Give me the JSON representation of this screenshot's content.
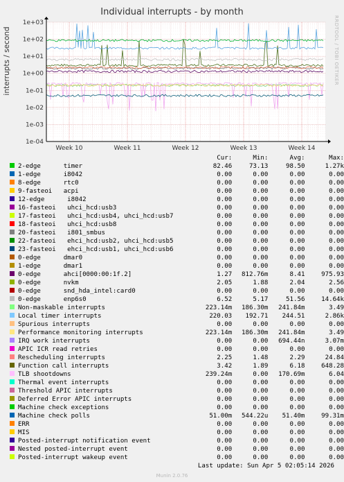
{
  "chart_data": {
    "type": "line",
    "title": "Individual interrupts - by month",
    "ylabel": "interrupts / second",
    "yscale": "log",
    "ylim": [
      0.0001,
      1000
    ],
    "yticks": [
      "1e+03",
      "1e+02",
      "1e+01",
      "1e+00",
      "1e-01",
      "1e-02",
      "1e-03",
      "1e-04"
    ],
    "xticks": [
      "Week 10",
      "Week 11",
      "Week 12",
      "Week 13",
      "Week 14"
    ],
    "grid": true,
    "series": [
      {
        "name": "Function call interrupts",
        "color": "#4a6e1a",
        "level": 3.0,
        "spikes": true
      },
      {
        "name": "Local timer interrupts",
        "color": "#5aa5e0",
        "level": 30.0,
        "spikes": true
      },
      {
        "name": "Non-maskable interrupts",
        "color": "#7ccf7c",
        "level": 0.2
      },
      {
        "name": "TLB shootdowns",
        "color": "#f0a8f0",
        "level": 0.25,
        "noisy": true
      },
      {
        "name": "Performance monitoring interrupts",
        "color": "#f0d878",
        "level": 0.2
      },
      {
        "name": "Machine check polls",
        "color": "#0b5e7a",
        "level": 0.05
      },
      {
        "name": "ahci[0000:00:1f.2]",
        "color": "#5a0a64",
        "level": 1.3
      },
      {
        "name": "timer",
        "color": "#00b030",
        "level": 85.0
      },
      {
        "name": "enp6s0",
        "color": "#c0c0c0",
        "level": 6.5
      },
      {
        "name": "nvkm",
        "color": "#787878",
        "level": 2.0
      },
      {
        "name": "Rescheduling interrupts",
        "color": "#e07050",
        "level": 2.2
      }
    ]
  },
  "legend": {
    "headers": [
      "Cur:",
      "Min:",
      "Avg:",
      "Max:"
    ],
    "rows": [
      {
        "label": "2-edge      timer",
        "color": "#00cc00",
        "cur": "82.46",
        "min": "73.13",
        "avg": "98.50",
        "max": "1.27k"
      },
      {
        "label": "1-edge      i8042",
        "color": "#0066b3",
        "cur": "0.00",
        "min": "0.00",
        "avg": "0.00",
        "max": "0.00"
      },
      {
        "label": "8-edge      rtc0",
        "color": "#ff8000",
        "cur": "0.00",
        "min": "0.00",
        "avg": "0.00",
        "max": "0.00"
      },
      {
        "label": "9-fasteoi   acpi",
        "color": "#ffcc00",
        "cur": "0.00",
        "min": "0.00",
        "avg": "0.00",
        "max": "0.00"
      },
      {
        "label": "12-edge      i8042",
        "color": "#330099",
        "cur": "0.00",
        "min": "0.00",
        "avg": "0.00",
        "max": "0.00"
      },
      {
        "label": "16-fasteoi   uhci_hcd:usb3",
        "color": "#990099",
        "cur": "0.00",
        "min": "0.00",
        "avg": "0.00",
        "max": "0.00"
      },
      {
        "label": "17-fasteoi   uhci_hcd:usb4, uhci_hcd:usb7",
        "color": "#ccff00",
        "cur": "0.00",
        "min": "0.00",
        "avg": "0.00",
        "max": "0.00"
      },
      {
        "label": "18-fasteoi   uhci_hcd:usb8",
        "color": "#ff0000",
        "cur": "0.00",
        "min": "0.00",
        "avg": "0.00",
        "max": "0.00"
      },
      {
        "label": "20-fasteoi   i801_smbus",
        "color": "#808080",
        "cur": "0.00",
        "min": "0.00",
        "avg": "0.00",
        "max": "0.00"
      },
      {
        "label": "22-fasteoi   ehci_hcd:usb2, uhci_hcd:usb5",
        "color": "#008f00",
        "cur": "0.00",
        "min": "0.00",
        "avg": "0.00",
        "max": "0.00"
      },
      {
        "label": "23-fasteoi   ehci_hcd:usb1, uhci_hcd:usb6",
        "color": "#00487d",
        "cur": "0.00",
        "min": "0.00",
        "avg": "0.00",
        "max": "0.00"
      },
      {
        "label": "0-edge      dmar0",
        "color": "#b35a00",
        "cur": "0.00",
        "min": "0.00",
        "avg": "0.00",
        "max": "0.00"
      },
      {
        "label": "1-edge      dmar1",
        "color": "#b38f00",
        "cur": "0.00",
        "min": "0.00",
        "avg": "0.00",
        "max": "0.00"
      },
      {
        "label": "0-edge      ahci[0000:00:1f.2]",
        "color": "#6b006b",
        "cur": "1.27",
        "min": "812.76m",
        "avg": "8.41",
        "max": "975.93"
      },
      {
        "label": "0-edge      nvkm",
        "color": "#8fb300",
        "cur": "2.05",
        "min": "1.88",
        "avg": "2.04",
        "max": "2.56"
      },
      {
        "label": "0-edge      snd_hda_intel:card0",
        "color": "#b30000",
        "cur": "0.00",
        "min": "0.00",
        "avg": "0.00",
        "max": "0.00"
      },
      {
        "label": "0-edge      enp6s0",
        "color": "#bebebe",
        "cur": "6.52",
        "min": "5.17",
        "avg": "51.56",
        "max": "14.64k"
      },
      {
        "label": "Non-maskable interrupts",
        "color": "#80ff80",
        "cur": "223.14m",
        "min": "186.30m",
        "avg": "241.84m",
        "max": "3.49"
      },
      {
        "label": "Local timer interrupts",
        "color": "#80c9ff",
        "cur": "220.03",
        "min": "192.71",
        "avg": "244.51",
        "max": "2.86k"
      },
      {
        "label": "Spurious interrupts",
        "color": "#ffc080",
        "cur": "0.00",
        "min": "0.00",
        "avg": "0.00",
        "max": "0.00"
      },
      {
        "label": "Performance monitoring interrupts",
        "color": "#ffe680",
        "cur": "223.14m",
        "min": "186.30m",
        "avg": "241.84m",
        "max": "3.49"
      },
      {
        "label": "IRQ work interrupts",
        "color": "#aa80ff",
        "cur": "0.00",
        "min": "0.00",
        "avg": "694.44n",
        "max": "3.07m"
      },
      {
        "label": "APIC ICR read retries",
        "color": "#ee00cc",
        "cur": "0.00",
        "min": "0.00",
        "avg": "0.00",
        "max": "0.00"
      },
      {
        "label": "Rescheduling interrupts",
        "color": "#ff8080",
        "cur": "2.25",
        "min": "1.48",
        "avg": "2.29",
        "max": "24.84"
      },
      {
        "label": "Function call interrupts",
        "color": "#666600",
        "cur": "3.42",
        "min": "1.89",
        "avg": "6.18",
        "max": "648.28"
      },
      {
        "label": "TLB shootdowns",
        "color": "#ffbfff",
        "cur": "239.24m",
        "min": "0.00",
        "avg": "170.69m",
        "max": "6.04"
      },
      {
        "label": "Thermal event interrupts",
        "color": "#00ffcc",
        "cur": "0.00",
        "min": "0.00",
        "avg": "0.00",
        "max": "0.00"
      },
      {
        "label": "Threshold APIC interrupts",
        "color": "#cc6699",
        "cur": "0.00",
        "min": "0.00",
        "avg": "0.00",
        "max": "0.00"
      },
      {
        "label": "Deferred Error APIC interrupts",
        "color": "#999900",
        "cur": "0.00",
        "min": "0.00",
        "avg": "0.00",
        "max": "0.00"
      },
      {
        "label": "Machine check exceptions",
        "color": "#00cc00",
        "cur": "0.00",
        "min": "0.00",
        "avg": "0.00",
        "max": "0.00"
      },
      {
        "label": "Machine check polls",
        "color": "#0066b3",
        "cur": "51.00m",
        "min": "544.22u",
        "avg": "51.40m",
        "max": "99.31m"
      },
      {
        "label": "ERR",
        "color": "#ff8000",
        "cur": "0.00",
        "min": "0.00",
        "avg": "0.00",
        "max": "0.00"
      },
      {
        "label": "MIS",
        "color": "#ffcc00",
        "cur": "0.00",
        "min": "0.00",
        "avg": "0.00",
        "max": "0.00"
      },
      {
        "label": "Posted-interrupt notification event",
        "color": "#330099",
        "cur": "0.00",
        "min": "0.00",
        "avg": "0.00",
        "max": "0.00"
      },
      {
        "label": "Nested posted-interrupt event",
        "color": "#990099",
        "cur": "0.00",
        "min": "0.00",
        "avg": "0.00",
        "max": "0.00"
      },
      {
        "label": "Posted-interrupt wakeup event",
        "color": "#ccff00",
        "cur": "0.00",
        "min": "0.00",
        "avg": "0.00",
        "max": "0.00"
      }
    ]
  },
  "last_update": "Last update:  Sun Apr  5 02:05:14 2026",
  "watermark": "RRDTOOL / TOBI OETIKER",
  "footer": "Munin 2.0.76"
}
